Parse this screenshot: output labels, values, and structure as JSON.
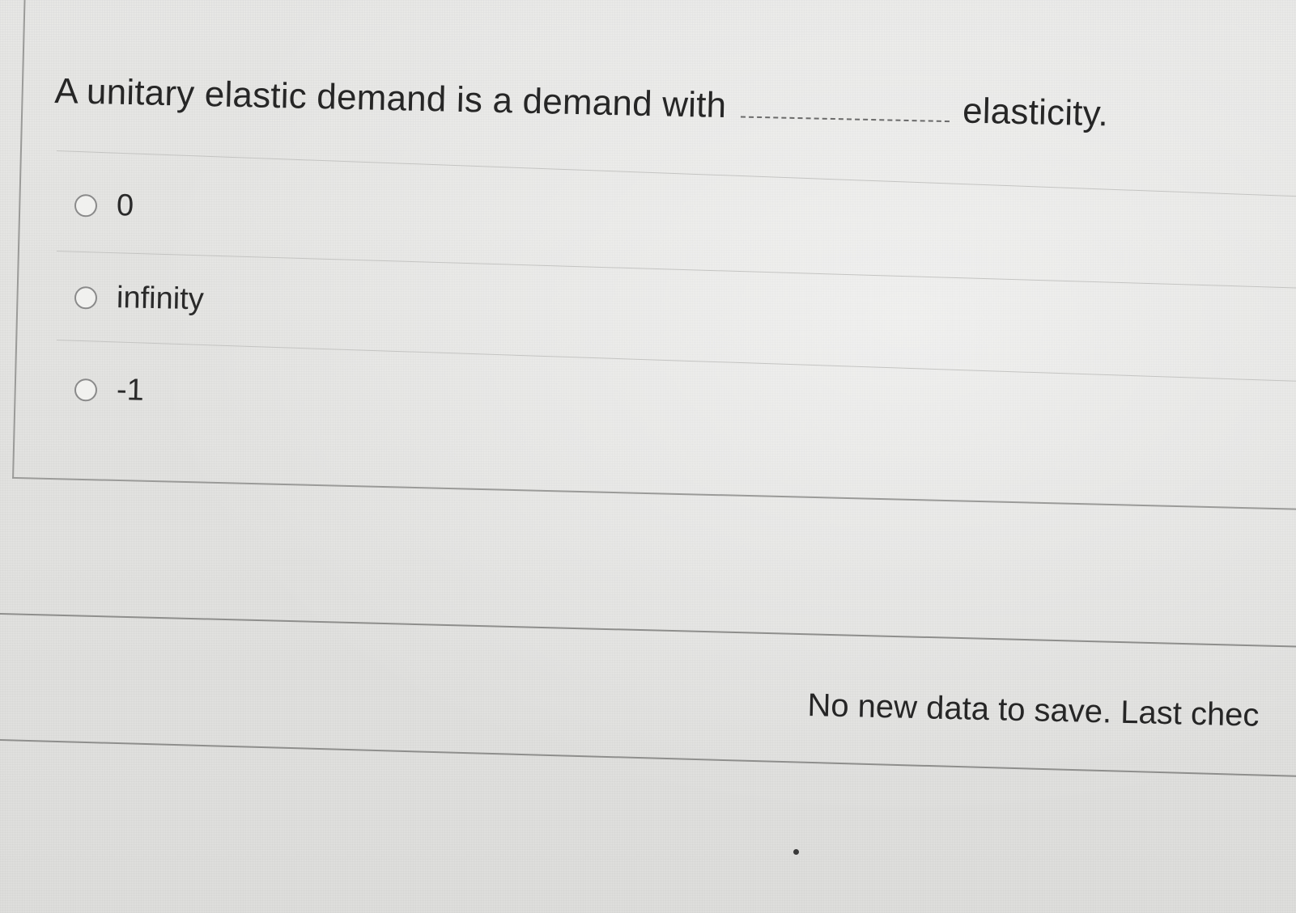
{
  "question": {
    "prefix": "A unitary elastic demand is a demand with",
    "suffix": "elasticity."
  },
  "options": [
    {
      "label": "0"
    },
    {
      "label": "infinity"
    },
    {
      "label": "-1"
    }
  ],
  "status": {
    "save_message": "No new data to save. Last chec"
  }
}
